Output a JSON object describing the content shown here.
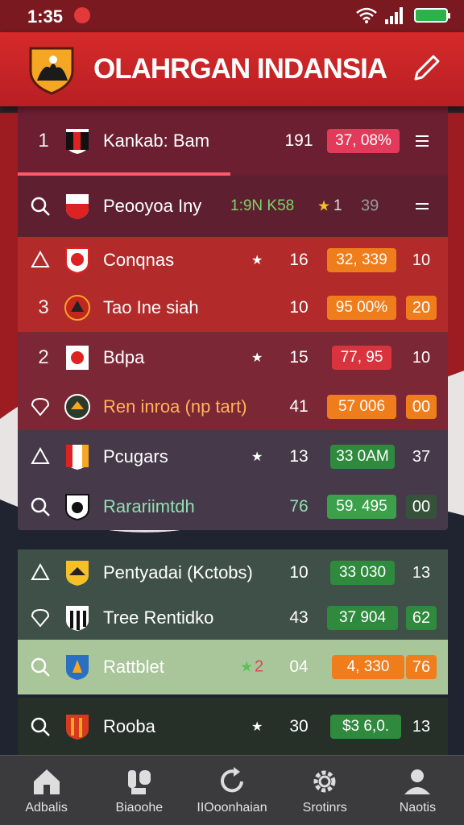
{
  "status": {
    "time": "1:35"
  },
  "header": {
    "title": "OLAHRGAN INDANSIA"
  },
  "rows": [
    {
      "rank": "1",
      "name": "Kankab: Bam",
      "points": "191",
      "value": "37, 08%"
    },
    {
      "name": "Peooyoa Iny",
      "stat": "1:9N K58",
      "stars": "1",
      "last": "39"
    },
    {
      "name": "Conqnas",
      "points": "16",
      "value": "32, 339",
      "last": "10"
    },
    {
      "rank": "3",
      "name": "Tao Ine siah",
      "points": "10",
      "value": "95 00%",
      "last": "20"
    },
    {
      "rank": "2",
      "name": "Bdpa",
      "points": "15",
      "value": "77, 95",
      "last": "10"
    },
    {
      "name": "Ren inroa (np tart)",
      "points": "41",
      "value": "57 006",
      "last": "00"
    },
    {
      "name": "Pcugars",
      "points": "13",
      "value": "33 0AM",
      "last": "37"
    },
    {
      "name": "Rarariimtdh",
      "points": "76",
      "value": "59. 495",
      "last": "00"
    },
    {
      "name": "Pentyadai (Kctobs)",
      "points": "10",
      "value": "33 030",
      "last": "13"
    },
    {
      "name": "Tree Rentidko",
      "points": "43",
      "value": "37 904",
      "last": "62"
    },
    {
      "name": "Rattblet",
      "stars": "2",
      "points": "04",
      "value": "4, 330",
      "last": "76"
    },
    {
      "name": "Rooba",
      "points": "30",
      "value": "$3 6,0.",
      "last": "13"
    }
  ],
  "nav": [
    {
      "label": "Adbalis",
      "icon": "home-icon"
    },
    {
      "label": "Biaoohe",
      "icon": "players-icon"
    },
    {
      "label": "IIOoonhaian",
      "icon": "refresh-icon"
    },
    {
      "label": "Srotinrs",
      "icon": "settings-icon"
    },
    {
      "label": "Naotis",
      "icon": "profile-icon"
    }
  ],
  "colors": {
    "header": "#d62a2a",
    "red_pill": "#e23a5a",
    "orange_pill": "#f07d1c",
    "green_pill": "#2f8a3e"
  }
}
